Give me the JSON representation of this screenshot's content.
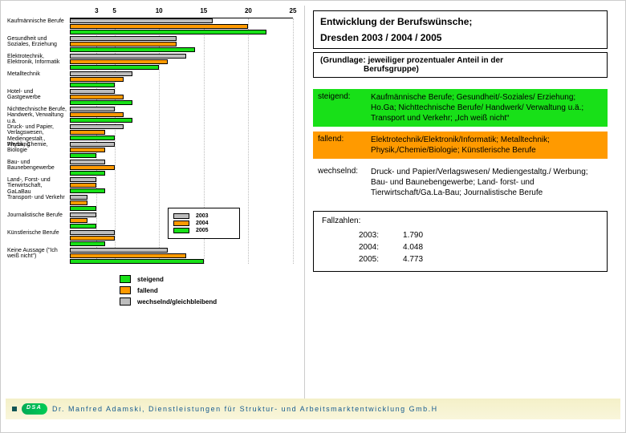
{
  "title_line1": "Entwicklung der Berufswünsche;",
  "title_line2": "Dresden 2003 / 2004 / 2005",
  "subtitle_line1": "(Grundlage: jeweiliger prozentualer Anteil in der",
  "subtitle_line2": "Berufsgruppe)",
  "trends": {
    "steigend": {
      "label": "steigend:",
      "desc": "Kaufmännische Berufe; Gesundheit/-Soziales/ Erziehung; Ho.Ga; Nichttechnische Berufe/ Handwerk/ Verwaltung u.ä.; Transport und Verkehr; „Ich weiß nicht“"
    },
    "fallend": {
      "label": "fallend:",
      "desc": "Elektrotechnik/Elektronik/Informatik; Metalltechnik; Physik,/Chemie/Biologie; Künstlerische Berufe"
    },
    "wechselnd": {
      "label": "wechselnd:",
      "desc": "Druck- und Papier/Verlagswesen/ Mediengestaltg./ Werbung; Bau- und Baunebengewerbe; Land- forst- und Tierwirtschaft/Ga.La-Bau; Journalistische Berufe"
    }
  },
  "fall_label": "Fallzahlen:",
  "fallzahlen": [
    {
      "year": "2003:",
      "value": "1.790"
    },
    {
      "year": "2004:",
      "value": "4.048"
    },
    {
      "year": "2005:",
      "value": "4.773"
    }
  ],
  "footer_text": "Dr. Manfred Adamski, Dienstleistungen für Struktur- und Arbeitsmarktentwicklung Gmb.H",
  "legend_years": {
    "y2003": "2003",
    "y2004": "2004",
    "y2005": "2005"
  },
  "legend_trend": {
    "steigend": "steigend",
    "fallend": "fallend",
    "wechselnd": "wechselnd/gleichbleibend"
  },
  "chart_data": {
    "type": "bar",
    "orientation": "horizontal",
    "title": "Entwicklung der Berufswünsche; Dresden 2003 / 2004 / 2005",
    "xlabel": "",
    "ylabel": "",
    "xlim": [
      0,
      25
    ],
    "x_ticks": [
      3,
      5,
      10,
      15,
      20,
      25
    ],
    "categories": [
      "Kaufmännische Berufe",
      "Gesundheit und Soziales, Erziehung",
      "Elektrotechnik, Elektronik, Informatik",
      "Metalltechnik",
      "Hotel- und Gastgewerbe",
      "Nichttechnische Berufe, Handwerk, Verwaltung u.ä.",
      "Druck- und Papier, Verlagswesen, Mediengestalt., Werbung",
      "Physik, Chemie, Biologie",
      "Bau- und Baunebengewerbe",
      "Land-, Forst- und Tierwirtschaft, GaLaBau",
      "Transport- und Verkehr",
      "Journalistische Berufe",
      "Künstlerische Berufe",
      "Keine Aussage (\"Ich weiß nicht\")"
    ],
    "series": [
      {
        "name": "2003",
        "color": "#bdbdbd",
        "values": [
          16,
          12,
          13,
          7,
          5,
          5,
          6,
          5,
          4,
          3,
          2,
          3,
          5,
          11
        ]
      },
      {
        "name": "2004",
        "color": "#ff9a00",
        "values": [
          20,
          12,
          11,
          6,
          6,
          6,
          4,
          4,
          5,
          3,
          2,
          2,
          5,
          13
        ]
      },
      {
        "name": "2005",
        "color": "#18e018",
        "values": [
          22,
          14,
          10,
          5,
          7,
          7,
          5,
          3,
          4,
          4,
          3,
          3,
          4,
          15
        ]
      }
    ],
    "category_trend": [
      "steigend",
      "steigend",
      "fallend",
      "fallend",
      "steigend",
      "steigend",
      "wechselnd",
      "fallend",
      "wechselnd",
      "wechselnd",
      "steigend",
      "wechselnd",
      "fallend",
      "steigend"
    ]
  }
}
